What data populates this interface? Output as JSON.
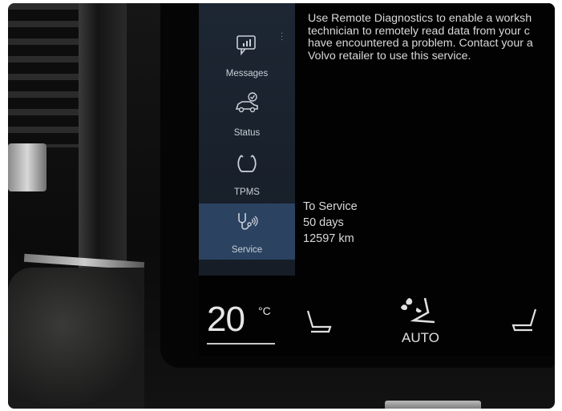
{
  "sidebar": {
    "items": [
      {
        "label": "Messages",
        "icon": "messages-icon"
      },
      {
        "label": "Status",
        "icon": "car-status-icon"
      },
      {
        "label": "TPMS",
        "icon": "tire-pressure-icon"
      },
      {
        "label": "Service",
        "icon": "stethoscope-icon"
      }
    ],
    "active": "Service"
  },
  "message": {
    "lines": [
      "Use Remote Diagnostics to enable a worksh",
      "technician to remotely read data from your c",
      "have encountered a problem. Contact your a",
      "Volvo retailer to use this service."
    ]
  },
  "service": {
    "title": "To Service",
    "days": "50 days",
    "distance": "12597 km"
  },
  "climate": {
    "temperature": "20",
    "unit": "°C",
    "fan_mode": "AUTO"
  },
  "colors": {
    "sidebar": "#1d2633",
    "active_item": "#2b4361",
    "text": "#d9d9d9"
  }
}
